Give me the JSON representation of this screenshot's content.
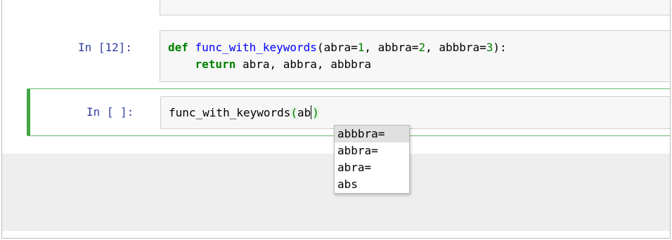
{
  "cells": [
    {
      "prompt": "In [12]:",
      "code": {
        "line1": {
          "def_kw": "def",
          "func_name": "func_with_keywords",
          "p1": "(abra=",
          "v1": "1",
          "p2": ", abbra=",
          "v2": "2",
          "p3": ", abbbra=",
          "v3": "3",
          "p4": "):"
        },
        "line2": {
          "indent": "    ",
          "return_kw": "return",
          "rest": " abra, abbra, abbbra"
        }
      }
    },
    {
      "prompt": "In [ ]:",
      "code": {
        "line1": {
          "call": "func_with_keywords",
          "open_paren": "(",
          "typed": "ab",
          "close_paren": ")"
        }
      }
    }
  ],
  "completer": {
    "options": [
      "abbbra=",
      "abbra=",
      "abra=",
      "abs"
    ],
    "selected_index": 0
  },
  "colors": {
    "prompt": "#303f9f",
    "keyword": "#008000",
    "function_def": "#0000ff",
    "selected_cell_border": "#42a545"
  }
}
